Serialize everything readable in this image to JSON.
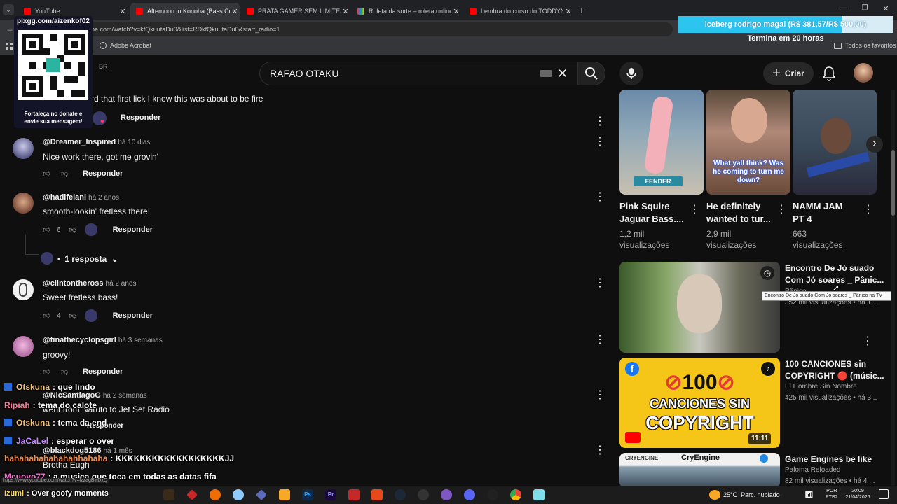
{
  "browser": {
    "tabs": [
      {
        "label": "YouTube",
        "color": "#ff0000"
      },
      {
        "label": "Afternoon in Konoha (Bass Cov",
        "color": "#ff0000"
      },
      {
        "label": "PRATA GAMER SEM LIMITES - Y",
        "color": "#ff0000"
      },
      {
        "label": "Roleta da sorte – roleta online",
        "color": "#7e57c2"
      },
      {
        "label": "Lembra do curso do TODDYN",
        "color": "#ff0000"
      }
    ],
    "url": "be.com/watch?v=kfQkuutaDu0&list=RDkfQkuutaDu0&start_radio=1",
    "bookmark": "Adobe Acrobat",
    "all_favorites": "Todos os favoritos"
  },
  "overlay": {
    "pix_site": "pixgg.com/aizenkof02",
    "pix_msg": "Fortaleça no donate e envie sua mensagem!",
    "goal_label": "iceberg rodrigo magal (R$ 381,57/R$ 500,00)",
    "goal_progress": 0.763,
    "goal_ends": "Termina em 20 horas"
  },
  "header": {
    "region": "BR",
    "search_value": "RAFAO OTAKU",
    "create_label": "Criar"
  },
  "comments": [
    {
      "text": "rd that first lick I knew this was about to be fire",
      "reply": "Responder"
    },
    {
      "author": "@Dreamer_Inspired",
      "ago": "há 10 dias",
      "text": "Nice work there, got me grovin'",
      "reply": "Responder"
    },
    {
      "author": "@hadifelani",
      "ago": "há 2 anos",
      "text": "smooth-lookin' fretless there!",
      "likes": "6",
      "reply": "Responder",
      "replies": "1 resposta"
    },
    {
      "author": "@clintontheross",
      "ago": "há 2 anos",
      "text": "Sweet fretless bass!",
      "likes": "4",
      "reply": "Responder"
    },
    {
      "author": "@tinathecyclopsgirl",
      "ago": "há 3 semanas",
      "text": "groovy!",
      "reply": "Responder"
    },
    {
      "author": "@NicSantiagoG",
      "ago": "há 2 semanas",
      "text": "went from Naruto to Jet Set Radio",
      "reply": "Responder"
    },
    {
      "author": "@blackdog5186",
      "ago": "há 1 mês",
      "text": "Brotha Eugh"
    }
  ],
  "related_shorts": [
    {
      "title1": "Pink Squire",
      "title2": "Jaguar Bass....",
      "views1": "1,2 mil",
      "views2": "visualizações",
      "caption": "FENDER"
    },
    {
      "title1": "He definitely",
      "title2": "wanted to tur...",
      "views1": "2,9 mil",
      "views2": "visualizações",
      "caption": "What yall think? Was he coming to turn me down?"
    },
    {
      "title1": "NAMM JAM",
      "title2": "PT 4",
      "views1": "663",
      "views2": "visualizações"
    }
  ],
  "related_videos": [
    {
      "title1": "Encontro De Jó suado",
      "title2": "Com Jó soares _ Pânic...",
      "channel": "Pânico",
      "meta": "352 mil visualizações • há 1...",
      "tooltip": "Encontro De Jó suado Com Jó soares _ Pânico na TV"
    },
    {
      "title1": "100 CANCIONES sin",
      "title2": "COPYRIGHT 🔴 (músic...",
      "channel": "El Hombre Sin Nombre",
      "meta": "425 mil visualizações • há 3...",
      "thumb_text1": "100",
      "thumb_text2": "CANCIONES SIN",
      "thumb_text3": "COPYRIGHT",
      "duration": "11:11"
    },
    {
      "title1": "Game Engines be like",
      "channel": "Paloma Reloaded",
      "meta": "82 mil visualizações • há 4 ...",
      "thumb_brand": "CRYENGINE",
      "thumb_title": "CryEngine"
    }
  ],
  "chat": [
    {
      "name": "Otskuna",
      "msg": "que lindo",
      "color": "#f0c27a"
    },
    {
      "name": "Ripiah",
      "msg": "tema do calote",
      "color": "#ff7a9a"
    },
    {
      "name": "Otskuna",
      "msg": "tema da end",
      "color": "#f0c27a"
    },
    {
      "name": "JaCaLel",
      "msg": "esperar o over",
      "color": "#c78bff"
    },
    {
      "name": "hahahahahahahahhahaha",
      "msg": "KKKKKKKKKKKKKKKKKKJJ",
      "color": "#ff8a3d"
    },
    {
      "name": "Meuovo77",
      "msg": "a musica que toca em todas as datas fifa",
      "color": "#ff6ad5"
    },
    {
      "name": "Izumi",
      "msg": "Over goofy moments",
      "color": "#ffd94a"
    }
  ],
  "status_url": "https://www.youtube.com/watch?v=lzzagBYDxQ",
  "taskbar": {
    "weather": "25°C  Parc. nublado",
    "lang1": "POR",
    "lang2": "PTB2",
    "time": "20:09",
    "date": "21/04/2026"
  }
}
